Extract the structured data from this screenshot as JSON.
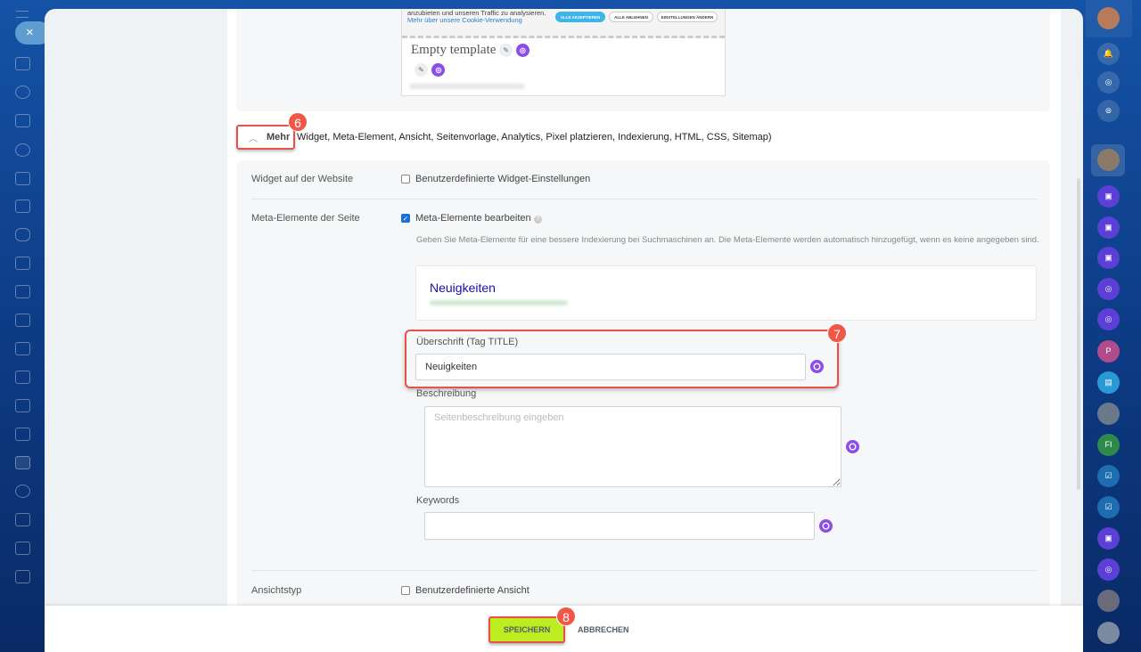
{
  "nav": {
    "close_label": "×"
  },
  "preview": {
    "cookie_text": "personalisieren, Funktionen sozialer Medien anzubieten und unseren Traffic zu analysieren.",
    "cookie_link": "Mehr über unsere Cookie-Verwendung",
    "accept_all": "ALLE AKZEPTIEREN",
    "reject_all": "ALLE ABLEHNEN",
    "change_settings": "EINSTELLUNGEN ÄNDERN",
    "template_title": "Empty template"
  },
  "more": {
    "label": "Mehr",
    "items": "Widget,  Meta-Element,  Ansicht,  Seitenvorlage,  Analytics,  Pixel platzieren,  Indexierung,  HTML,  CSS,  Sitemap)"
  },
  "badges": {
    "b6": "6",
    "b7": "7",
    "b8": "8"
  },
  "settings": {
    "widget": {
      "label": "Widget auf der Website",
      "option": "Benutzerdefinierte Widget-Einstellungen",
      "checked": false
    },
    "meta": {
      "label": "Meta-Elemente der Seite",
      "option": "Meta-Elemente bearbeiten",
      "checked": true,
      "hint": "Geben Sie Meta-Elemente für eine bessere Indexierung bei Suchmaschinen an. Die Meta-Elemente werden automatisch hinzugefügt, wenn es keine angegeben sind.",
      "serp_title": "Neuigkeiten",
      "title_label": "Überschrift (Tag TITLE)",
      "title_value": "Neuigkeiten",
      "desc_label": "Beschreibung",
      "desc_placeholder": "Seitenbeschreibung eingeben",
      "keywords_label": "Keywords",
      "keywords_value": ""
    },
    "view": {
      "label": "Ansichtstyp",
      "option": "Benutzerdefinierte Ansicht",
      "checked": false
    }
  },
  "footer": {
    "save": "SPEICHERN",
    "cancel": "ABBRECHEN"
  },
  "rightbar": {
    "p": "P",
    "fi": "FI"
  },
  "colors": {
    "accent": "#bbed21",
    "highlight": "#e8514a",
    "copilot": "#8a4de8"
  }
}
